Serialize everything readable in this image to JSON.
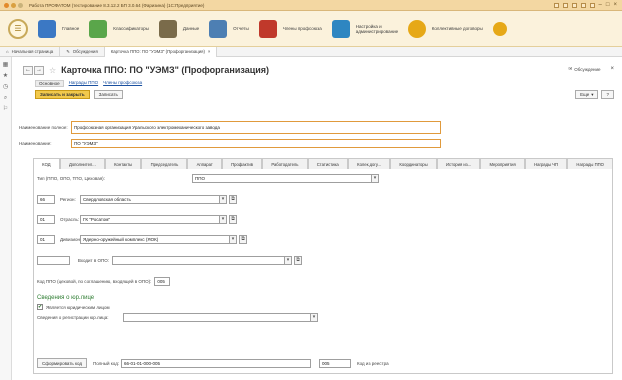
{
  "window": {
    "title": "Работа ПРОФАТОМ (тестирование 8.3.12.2 БП 3.0.64 (Фаризина) (1С:Предприятие)"
  },
  "sections": [
    {
      "label": "Главное",
      "color": "#3b78c4"
    },
    {
      "label": "Классификаторы",
      "color": "#5aa64a"
    },
    {
      "label": "Данные",
      "color": "#7a6b4a"
    },
    {
      "label": "Отчеты",
      "color": "#4d7fb3"
    },
    {
      "label": "Члены профсоюза",
      "color": "#c0392b"
    },
    {
      "label": "Настройка и администрирование",
      "color": "#2e86c1"
    },
    {
      "label": "Коллективные договоры",
      "color": "#e6a817"
    }
  ],
  "open_windows": {
    "home": "Начальная страница",
    "discussions": "Обсуждения",
    "card": "Карточка ППО: ПО \"УЭМЗ\" (Профорганизация)"
  },
  "form": {
    "title": "Карточка ППО: ПО \"УЭМЗ\" (Профорганизация)",
    "discussion_label": "Обсуждение",
    "tabs": [
      "Основное",
      "Награды ППО",
      "Члены профсоюза"
    ],
    "buttons": {
      "save_close": "Записать и закрыть",
      "save": "Записать",
      "more": "Еще",
      "help": "?"
    },
    "full_name_label": "Наименование полное:",
    "full_name_value": "Профсоюзная организация Уральского электромеханического завода",
    "name_label": "Наименование:",
    "name_value": "ПО \"УЭМЗ\"",
    "inner_tabs": [
      "КОД",
      "Дополнител...",
      "Контакты",
      "Председатель",
      "Аппарат",
      "Профактив",
      "Работодатель",
      "Статистика",
      "Колек.догу...",
      "Координаторы",
      "История из...",
      "Мероприятия",
      "Награды ЧП",
      "Награды ППО"
    ],
    "type_label": "Тип (ППО, ОПО, ТПО, Цеховая):",
    "type_value": "ППО",
    "region_code": "66",
    "region_label": "Регион:",
    "region_value": "Свердловская область",
    "branch_code": "01",
    "branch_label": "Отрасль:",
    "branch_value": "ГК \"Росатом\"",
    "division_code": "01",
    "division_label": "Дивизион:",
    "division_value": "Ядерно-оружейный комплекс (ЯОК)",
    "opo_label": "Входит в ОПО:",
    "opo_value": "",
    "ppo_code_label": "Код ППО (цеховой, по соглашению, входящей в ОПО):",
    "ppo_code_value": "005",
    "legal_title": "Сведения о юр.лице",
    "legal_check_label": "Является юридическим лицом",
    "legal_check_mark": "✔",
    "registry_label": "Сведения о регистрации юр.лица:",
    "registry_value": "",
    "gen_code_button": "Сформировать код",
    "full_code_label": "Полный код:",
    "full_code_value": "66-01-01-000-005",
    "registry_code_value": "005",
    "registry_code_label": "Код из реестра"
  },
  "left_panel_icons": [
    "grid-icon",
    "star-icon",
    "history-icon",
    "search-icon",
    "bell-icon"
  ]
}
